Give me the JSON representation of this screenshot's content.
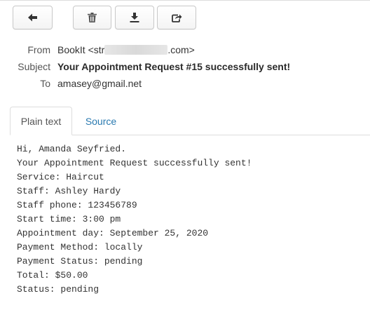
{
  "toolbar": {
    "buttons": [
      {
        "name": "back",
        "icon": "arrow-left-icon"
      },
      {
        "name": "delete",
        "icon": "trash-icon"
      },
      {
        "name": "download",
        "icon": "download-icon"
      },
      {
        "name": "forward",
        "icon": "share-icon"
      }
    ]
  },
  "headers": {
    "from_label": "From",
    "from_value_prefix": "BookIt <str",
    "from_value_suffix": ".com>",
    "subject_label": "Subject",
    "subject_value": "Your Appointment Request #15 successfully sent!",
    "to_label": "To",
    "to_value": "amasey@gmail.net"
  },
  "tabs": [
    {
      "label": "Plain text",
      "active": true
    },
    {
      "label": "Source",
      "active": false
    }
  ],
  "message": {
    "lines": [
      "Hi, Amanda Seyfried.",
      "Your Appointment Request successfully sent!",
      "Service: Haircut",
      "Staff: Ashley Hardy",
      "Staff phone: 123456789",
      "Start time: 3:00 pm",
      "Appointment day: September 25, 2020",
      "Payment Method: locally",
      "Payment Status: pending",
      "Total: $50.00",
      "Status: pending"
    ]
  },
  "colors": {
    "link": "#2a7ab0",
    "text": "#333333",
    "border": "#dddddd"
  }
}
